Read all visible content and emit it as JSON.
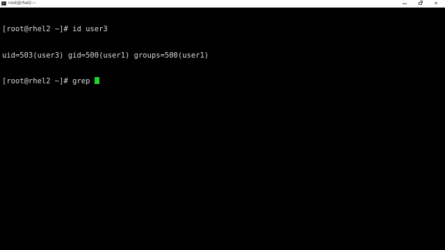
{
  "window": {
    "title": "root@rhel2:~",
    "minimize_glyph": "—",
    "close_glyph": "✕"
  },
  "terminal": {
    "lines": [
      "[root@rhel2 ~]# id user3",
      "uid=503(user3) gid=500(user1) groups=500(user1)",
      "[root@rhel2 ~]# grep "
    ],
    "cursor_color": "#22d12a",
    "background": "#000000",
    "foreground": "#dcdcdc"
  }
}
